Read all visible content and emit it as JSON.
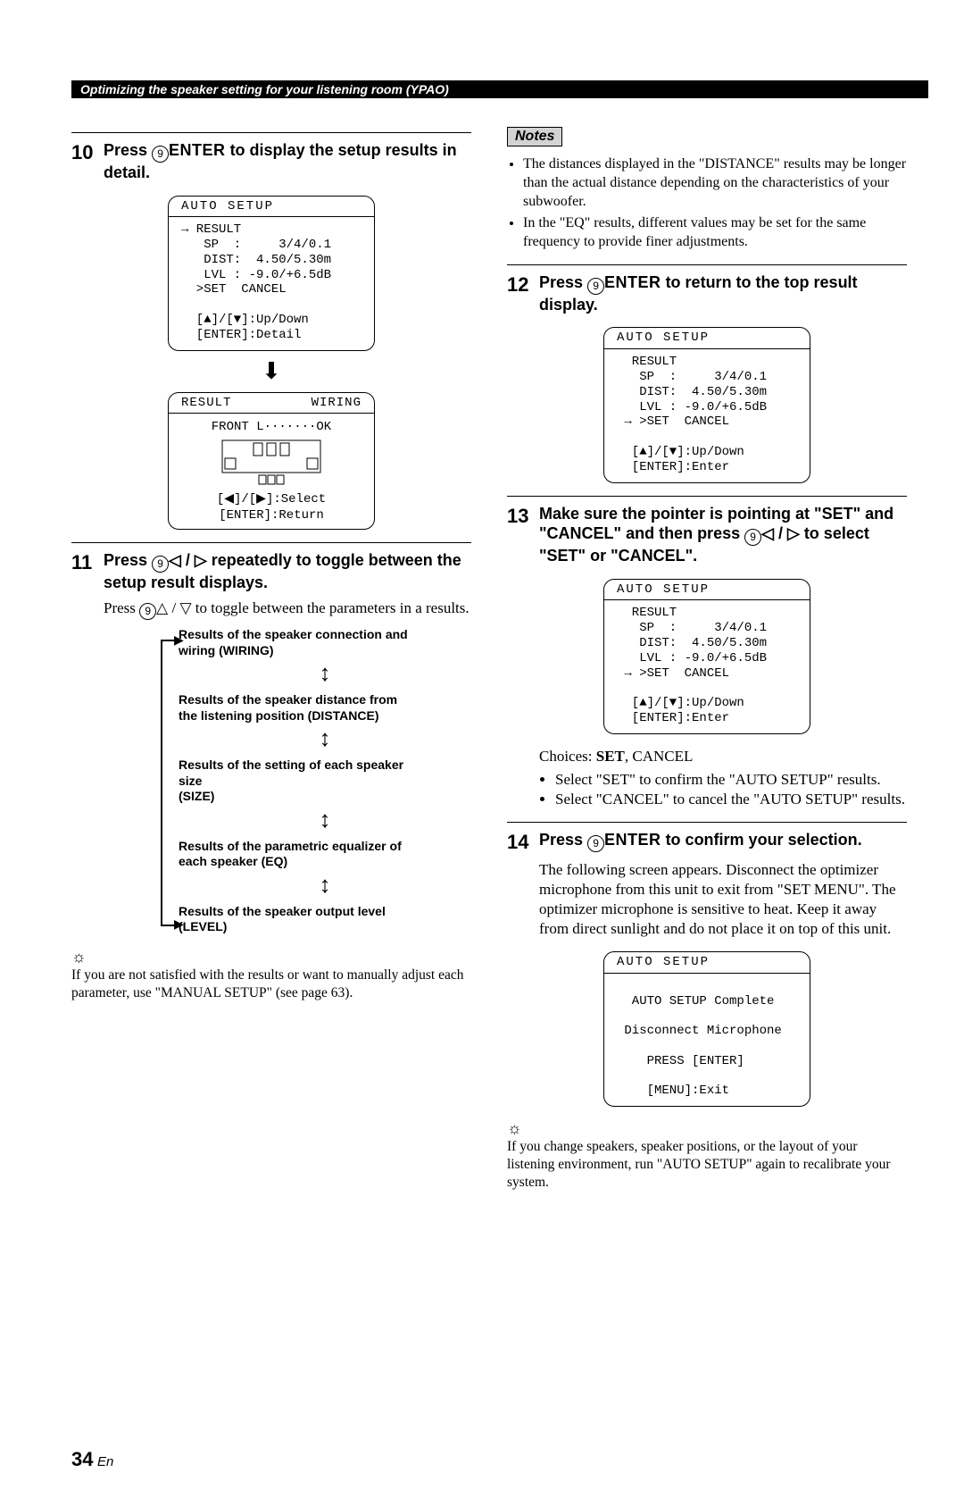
{
  "header": "Optimizing the speaker setting for your listening room (YPAO)",
  "circled": "9",
  "enter_key": "ENTER",
  "tri_l": "◁",
  "tri_r": "▷",
  "tri_u": "△",
  "tri_d": "▽",
  "step10": {
    "num": "10",
    "title_a": "Press ",
    "title_b": " to display the setup results in detail."
  },
  "step11": {
    "num": "11",
    "title_a": "Press ",
    "title_b": " repeatedly to toggle between the setup result displays.",
    "body_a": "Press ",
    "body_b": " to toggle between the parameters in a results."
  },
  "step12": {
    "num": "12",
    "title_a": "Press ",
    "title_b": " to return to the top result display."
  },
  "step13": {
    "num": "13",
    "title_a": "Make sure the pointer is pointing at \"SET\" and \"CANCEL\" and then press ",
    "title_b": " to select \"SET\" or \"CANCEL\"."
  },
  "step14": {
    "num": "14",
    "title_a": "Press ",
    "title_b": " to confirm your selection.",
    "body": "The following screen appears. Disconnect the optimizer microphone from this unit to exit from \"SET MENU\". The optimizer microphone is sensitive to heat. Keep it away from direct sunlight and do not place it on top of this unit."
  },
  "lcd_auto_title": "AUTO SETUP",
  "lcd1_body": "→ RESULT\n   SP  :     3/4/0.1\n   DIST:  4.50/5.30m\n   LVL : -9.0/+6.5dB\n  >SET  CANCEL\n\n  [▲]/[▼]:Up/Down\n  [ENTER]:Detail",
  "lcd2_top_l": "RESULT",
  "lcd2_top_r": "WIRING",
  "lcd2_line": "FRONT L·······OK",
  "lcd2_foot": "[◀]/[▶]:Select\n[ENTER]:Return",
  "lcd3_body": "  RESULT\n   SP  :     3/4/0.1\n   DIST:  4.50/5.30m\n   LVL : -9.0/+6.5dB\n → >SET  CANCEL\n\n  [▲]/[▼]:Up/Down\n  [ENTER]:Enter",
  "lcd5_body": "\n  AUTO SETUP Complete\n\n Disconnect Microphone\n\n    PRESS [ENTER]\n\n    [MENU]:Exit",
  "flow": {
    "wiring": "Results of the speaker connection and wiring (WIRING)",
    "distance": "Results of the speaker distance from the listening position (DISTANCE)",
    "size": "Results of the setting of each speaker size\n(SIZE)",
    "eq": "Results of the parametric equalizer of each speaker (EQ)",
    "level": "Results of the speaker output level (LEVEL)"
  },
  "tip11": "If you are not satisfied with the results or want to manually adjust each parameter, use \"MANUAL SETUP\" (see page 63).",
  "notes_label": "Notes",
  "notes": {
    "a": "The distances displayed in the \"DISTANCE\" results may be longer than the actual distance depending on the characteristics of your subwoofer.",
    "b": "In the \"EQ\" results, different values may be set for the same frequency to provide finer adjustments."
  },
  "choices_label": "Choices: ",
  "choices_bold": "SET",
  "choices_rest": ", CANCEL",
  "choice_set": "Select \"SET\" to confirm the \"AUTO SETUP\" results.",
  "choice_cancel": "Select \"CANCEL\" to cancel the \"AUTO SETUP\" results.",
  "tip14": "If you change speakers, speaker positions, or the layout of your listening environment, run \"AUTO SETUP\" again to recalibrate your system.",
  "page_number": "34",
  "page_lang": "En"
}
